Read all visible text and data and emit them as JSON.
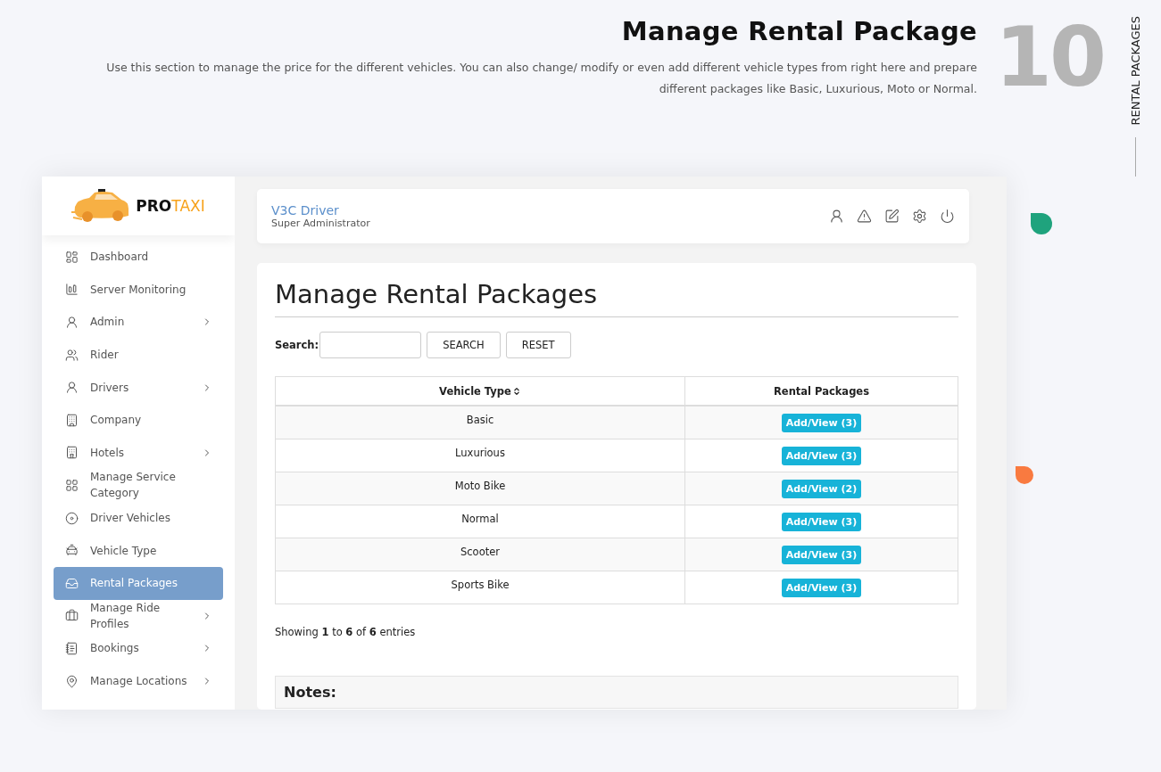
{
  "header": {
    "title": "Manage Rental Package",
    "description": "Use this section to manage the price for the different vehicles. You can also change/ modify or even add different vehicle types from right here and prepare different packages like Basic, Luxurious, Moto or Normal.",
    "number": "10",
    "side_label": "RENTAL PACKAGES"
  },
  "logo": {
    "part1": "PRO",
    "part2": "TAXI"
  },
  "sidebar": {
    "items": [
      {
        "label": "Dashboard",
        "submenu": false,
        "selected": false
      },
      {
        "label": "Server Monitoring",
        "submenu": false,
        "selected": false
      },
      {
        "label": "Admin",
        "submenu": true,
        "selected": false
      },
      {
        "label": "Rider",
        "submenu": false,
        "selected": false
      },
      {
        "label": "Drivers",
        "submenu": true,
        "selected": false
      },
      {
        "label": "Company",
        "submenu": false,
        "selected": false
      },
      {
        "label": "Hotels",
        "submenu": true,
        "selected": false
      },
      {
        "label": "Manage Service Category",
        "submenu": false,
        "selected": false
      },
      {
        "label": "Driver Vehicles",
        "submenu": false,
        "selected": false
      },
      {
        "label": "Vehicle Type",
        "submenu": false,
        "selected": false
      },
      {
        "label": "Rental Packages",
        "submenu": false,
        "selected": true
      },
      {
        "label": "Manage Ride Profiles",
        "submenu": true,
        "selected": false
      },
      {
        "label": "Bookings",
        "submenu": true,
        "selected": false
      },
      {
        "label": "Manage Locations",
        "submenu": true,
        "selected": false
      }
    ]
  },
  "topbar": {
    "user_name": "V3C Driver",
    "role": "Super Administrator"
  },
  "page": {
    "title": "Manage Rental Packages",
    "search_label": "Search:",
    "buttons": [
      "SEARCH",
      "RESET"
    ],
    "table": {
      "columns": [
        {
          "label": "Vehicle Type",
          "sortable": true
        },
        {
          "label": "Rental Packages",
          "sortable": false
        }
      ],
      "rows": [
        {
          "vehicle_type": "Basic",
          "action": "Add/View (3)"
        },
        {
          "vehicle_type": "Luxurious",
          "action": "Add/View (3)"
        },
        {
          "vehicle_type": "Moto Bike",
          "action": "Add/View (2)"
        },
        {
          "vehicle_type": "Normal",
          "action": "Add/View (3)"
        },
        {
          "vehicle_type": "Scooter",
          "action": "Add/View (3)"
        },
        {
          "vehicle_type": "Sports Bike",
          "action": "Add/View (3)"
        }
      ]
    },
    "info": "Showing **1** to **6** of **6** entries",
    "notes_title": "Notes:"
  }
}
